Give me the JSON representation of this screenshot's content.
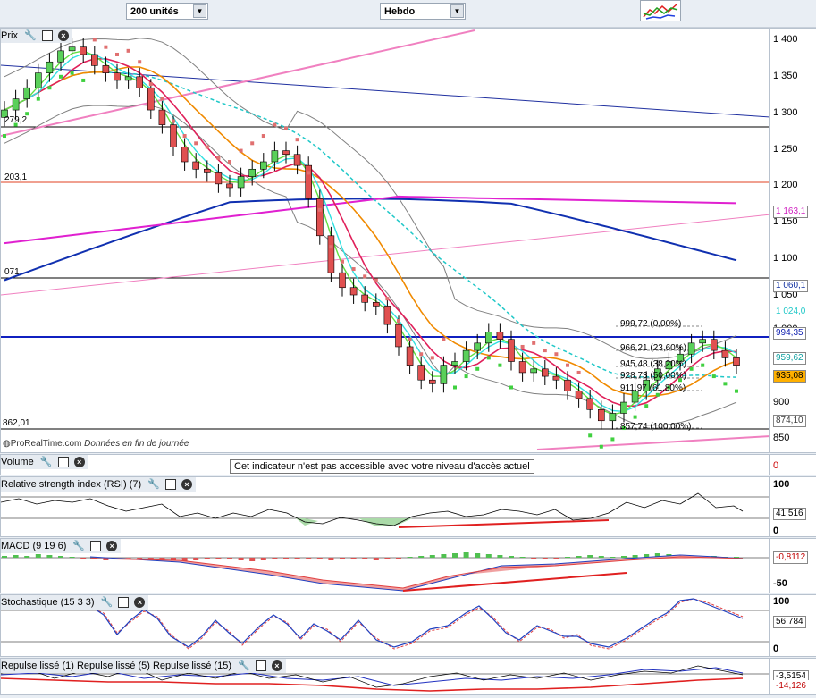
{
  "toolbar": {
    "units_label": "200 unités",
    "period_label": "Hebdo",
    "chart_tools_icon": "chart-indicators-icon"
  },
  "price_panel": {
    "title": "Prix",
    "footer_source": "ProRealTime.com",
    "footer_note": "Données en fin de journée",
    "left_labels": [
      "279,2",
      "203,1",
      "071",
      "862,01"
    ],
    "fib_labels": [
      "999,72 (0,00%)",
      "966,21 (23,60%)",
      "945,48 (38,20%)",
      "928,73 (50,00%)",
      "911,97 (61,80%)",
      "857,74 (100,00%)"
    ],
    "y_ticks": [
      "1 400",
      "1 350",
      "1 300",
      "1 250",
      "1 200",
      "1 150",
      "1 100",
      "1 050",
      "1 000",
      "950",
      "900",
      "850"
    ],
    "value_tags": [
      {
        "text": "1 163,1",
        "color": "#d020c0"
      },
      {
        "text": "1 060,1",
        "color": "#1030a0"
      },
      {
        "text": "1 024,0",
        "color": "#20c8c8"
      },
      {
        "text": "994,35",
        "color": "#1020b0"
      },
      {
        "text": "959,62",
        "color": "#10a0a0"
      },
      {
        "text": "935,08",
        "color": "#e08000"
      },
      {
        "text": "874,10",
        "color": "#606060"
      }
    ]
  },
  "volume_panel": {
    "title": "Volume",
    "notice": "Cet indicateur n'est pas accessible avec votre niveau d'accès actuel",
    "y_tick": "0"
  },
  "rsi_panel": {
    "title": "Relative strength index (RSI) (7)",
    "y_ticks": [
      "100",
      "0"
    ],
    "value_tag": "41,516"
  },
  "macd_panel": {
    "title": "MACD (9 19 6)",
    "y_ticks": [
      "-50"
    ],
    "value_tag": "-0,8112"
  },
  "stoch_panel": {
    "title": "Stochastique (15 3 3)",
    "y_ticks": [
      "100",
      "0"
    ],
    "value_tag": "56,784"
  },
  "repulse_panel": {
    "title": "Repulse lissé (1) Repulse lissé (5) Repulse lissé (15)",
    "value_tags": [
      "-3,5154",
      "-14,126"
    ]
  },
  "chart_data": {
    "type": "line",
    "title": "",
    "ylim": [
      835,
      1410
    ],
    "price_close": [
      1300,
      1315,
      1330,
      1350,
      1365,
      1380,
      1385,
      1375,
      1360,
      1350,
      1340,
      1345,
      1330,
      1300,
      1280,
      1250,
      1230,
      1220,
      1215,
      1200,
      1195,
      1210,
      1220,
      1230,
      1245,
      1240,
      1225,
      1180,
      1130,
      1080,
      1060,
      1050,
      1040,
      1035,
      1010,
      980,
      955,
      935,
      930,
      955,
      960,
      975,
      985,
      1000,
      990,
      960,
      945,
      950,
      940,
      935,
      920,
      910,
      895,
      880,
      890,
      905,
      920,
      935,
      950,
      960,
      970,
      985,
      990,
      975,
      965,
      955
    ]
  }
}
